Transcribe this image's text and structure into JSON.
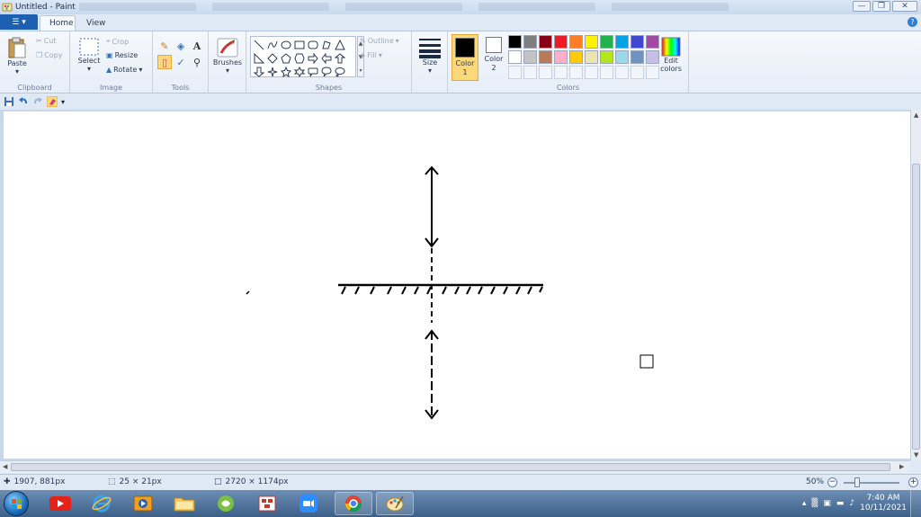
{
  "window": {
    "title": "Untitled - Paint"
  },
  "tabs": {
    "file_label": "☰ ▾",
    "home": "Home",
    "view": "View"
  },
  "clipboard": {
    "paste": "Paste",
    "cut": "Cut",
    "copy": "Copy",
    "label": "Clipboard"
  },
  "image": {
    "select": "Select",
    "crop": "Crop",
    "resize": "Resize",
    "rotate": "Rotate",
    "label": "Image"
  },
  "tools": {
    "label": "Tools"
  },
  "brushes": {
    "label": "Brushes"
  },
  "shapes": {
    "outline": "Outline",
    "fill": "Fill",
    "label": "Shapes"
  },
  "size": {
    "label": "Size"
  },
  "colors": {
    "color1_label": "Color\n1",
    "color2_label": "Color\n2",
    "edit_colors": "Edit colors",
    "label": "Colors",
    "color1": "#000000",
    "color2": "#ffffff",
    "palette": [
      "#000000",
      "#7f7f7f",
      "#880015",
      "#ed1c24",
      "#ff7f27",
      "#fff200",
      "#22b14c",
      "#00a2e8",
      "#3f48cc",
      "#a349a4",
      "#ffffff",
      "#c3c3c3",
      "#b97a57",
      "#ffaec9",
      "#ffc90e",
      "#efe4b0",
      "#b5e61d",
      "#99d9ea",
      "#7092be",
      "#c8bfe7"
    ]
  },
  "status": {
    "cursor_pos": "1907, 881px",
    "selection_size": "25 × 21px",
    "image_size": "2720 × 1174px",
    "zoom": "50%"
  },
  "taskbar": {
    "clock_time": "7:40 AM",
    "clock_date": "10/11/2021"
  }
}
